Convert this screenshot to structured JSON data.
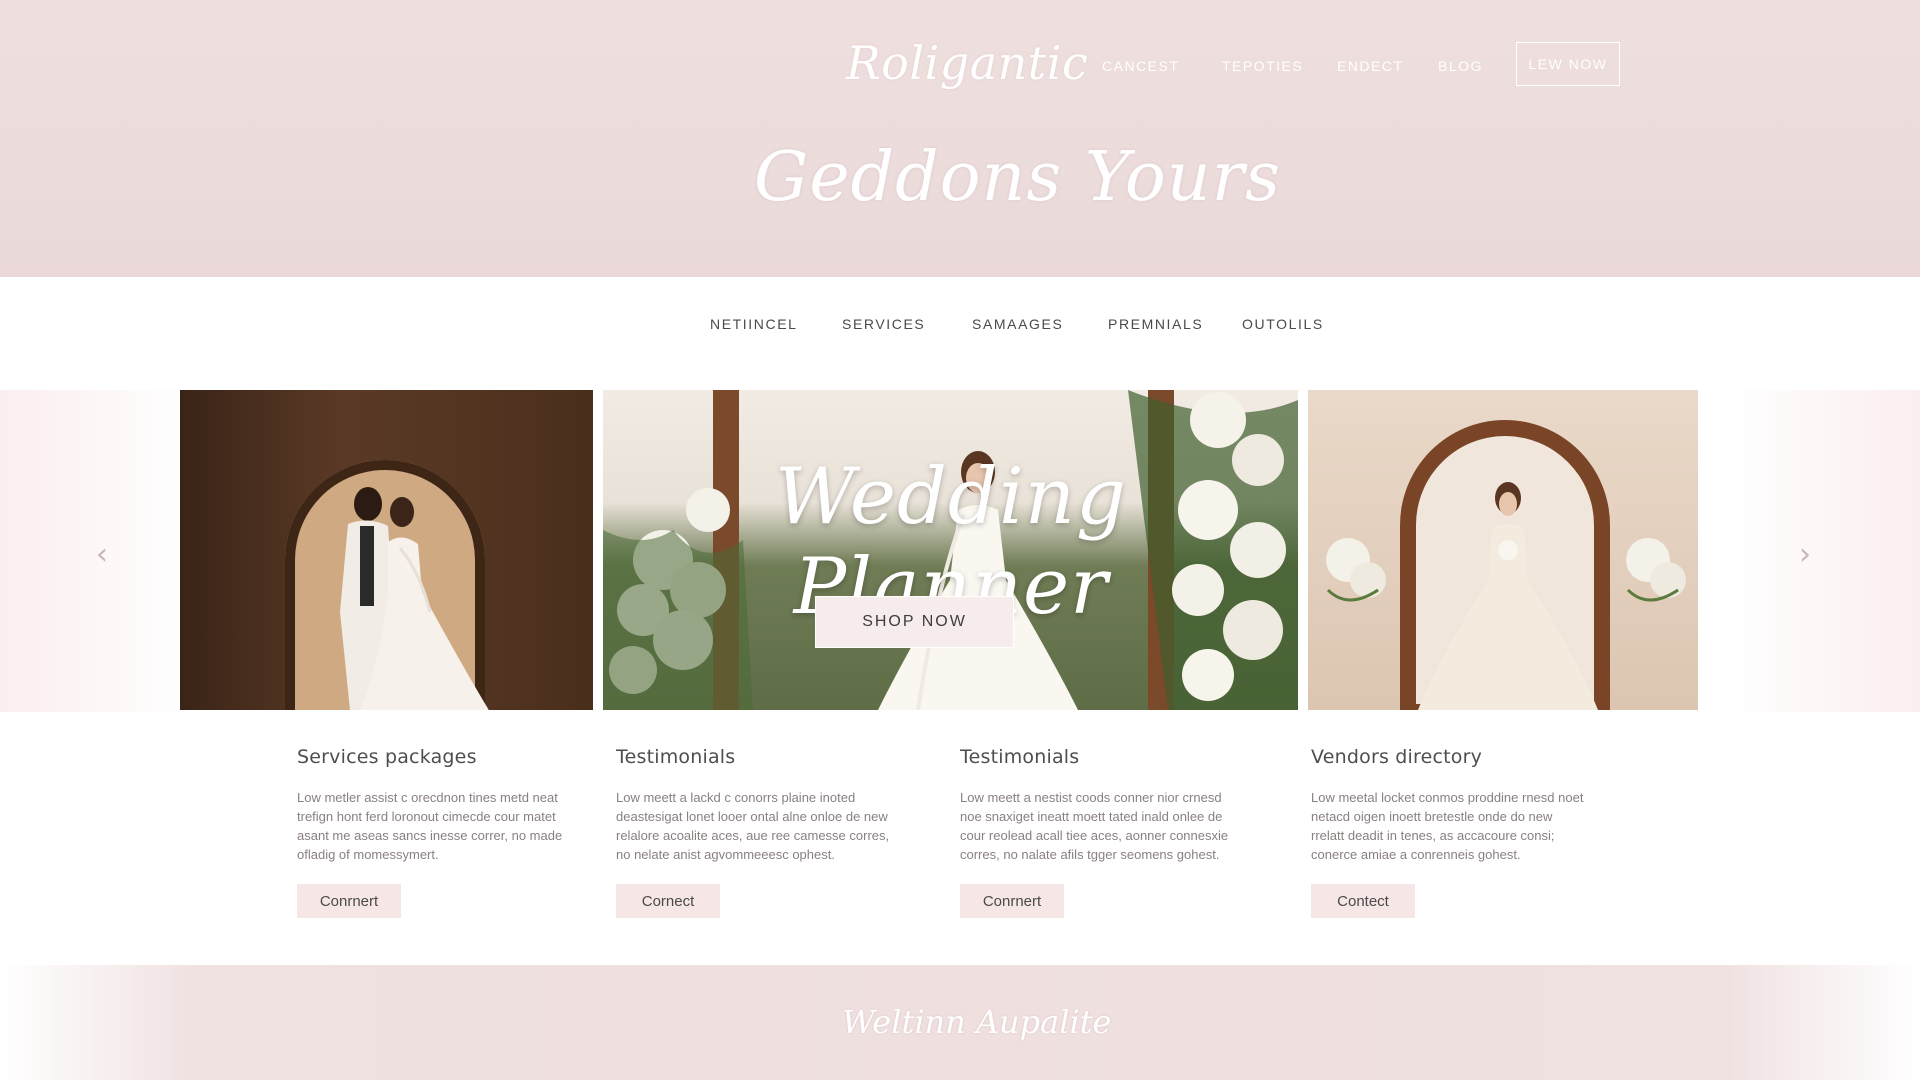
{
  "header": {
    "logo": "Roligantic",
    "nav": [
      "CANCEST",
      "TEPOTIES",
      "ENDECT",
      "BLOG"
    ],
    "cta": "LEW NOW",
    "hero_script": "Geddons Yours"
  },
  "sub_nav": [
    "NETIINCEL",
    "SERVICES",
    "SAMAAGES",
    "PREMNIALS",
    "OUTOLILS"
  ],
  "gallery": {
    "overlay_script": "Wedding Planner",
    "shop_button": "SHOP NOW",
    "prev_icon": "‹",
    "next_icon": "›"
  },
  "cards": [
    {
      "title": "Services packages",
      "body": "Low metler assist c orecdnon tines metd neat trefign hont ferd loronout cimecde cour matet asant me aseas sancs inesse correr, no made ofladig of momessymert.",
      "button": "Conrnert"
    },
    {
      "title": "Testimonials",
      "body": "Low meett a lackd c conorrs plaine inoted deastesigat lonet looer ontal alne onloe de new relalore acoalite aces, aue ree camesse corres, no nelate anist agvommeeesc ophest.",
      "button": "Cornect"
    },
    {
      "title": "Testimonials",
      "body": "Low meett a nestist coods conner nior crnesd noe snaxiget ineatt moett tated inald onlee de cour reolead acall tiee aces, aonner connesxie corres, no nalate afils tgger seomens gohest.",
      "button": "Conrnert"
    },
    {
      "title": "Vendors directory",
      "body": "Low meetal locket conmos proddine rnesd noet netacd oigen inoett bretestle onde do new rrelatt deadit in tenes, as accacoure consi; conerce amiae a conrenneis gohest.",
      "button": "Contect"
    }
  ],
  "footer": {
    "script": "Weltinn Aupalite"
  },
  "colors": {
    "blush": "#efdede",
    "button_pink": "#f7e6e6",
    "text_dark": "#4e4e4e",
    "text_muted": "#8a8080",
    "white": "#ffffff"
  }
}
